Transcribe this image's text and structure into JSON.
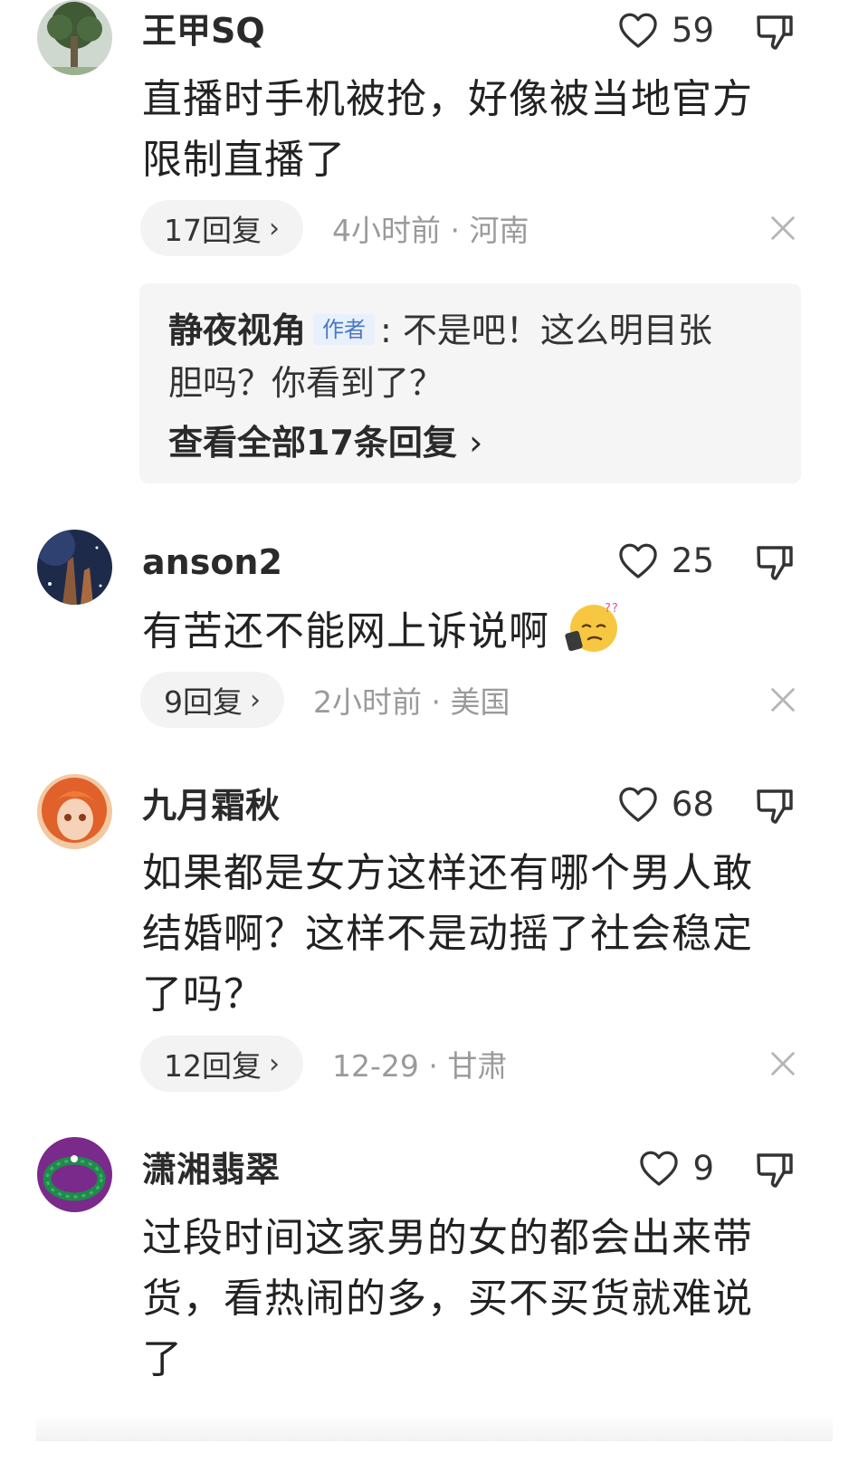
{
  "comments": [
    {
      "username": "王甲SQ",
      "like_count": "59",
      "text": [
        "直播时手机被抢，好像被当地官方",
        "限制直播了"
      ],
      "reply_label": "17回复",
      "meta": "4小时前 · 河南",
      "pinned_reply": {
        "author": "静夜视角",
        "tag": "作者",
        "text_line1": ": 不是吧！这么明目张",
        "text_line2": "胆吗？你看到了？",
        "view_all": "查看全部17条回复"
      }
    },
    {
      "username": "anson2",
      "like_count": "25",
      "text": [
        "有苦还不能网上诉说啊"
      ],
      "emoji": "sweat-confused-emoji",
      "reply_label": "9回复",
      "meta": "2小时前 · 美国"
    },
    {
      "username": "九月霜秋",
      "like_count": "68",
      "text": [
        "如果都是女方这样还有哪个男人敢",
        "结婚啊？这样不是动摇了社会稳定",
        "了吗？"
      ],
      "reply_label": "12回复",
      "meta": "12-29 · 甘肃"
    },
    {
      "username": "潇湘翡翠",
      "like_count": "9",
      "text": [
        "过段时间这家男的女的都会出来带",
        "货，看热闹的多，买不买货就难说",
        "了"
      ]
    }
  ],
  "colors": {
    "text": "#222222",
    "meta": "#9a9a9a",
    "pill_bg": "#f3f3f3",
    "author_tag": "#4a78c2"
  }
}
